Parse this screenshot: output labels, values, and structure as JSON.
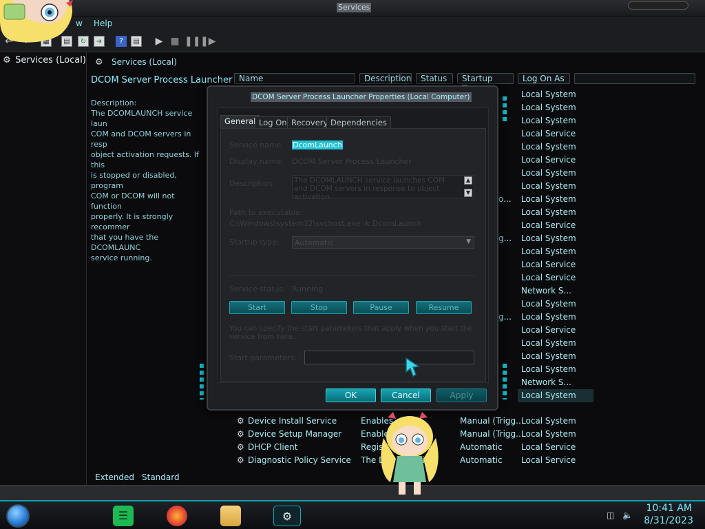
{
  "window": {
    "title": "Services"
  },
  "menu": {
    "items": [
      "w",
      "Help"
    ]
  },
  "tree": {
    "root_label": "Services (Local)"
  },
  "main": {
    "header_label": "Services (Local)",
    "selected_service_title": "DCOM Server Process Launcher",
    "description_lines": [
      "Description:",
      "The DCOMLAUNCH service laun",
      "COM and DCOM servers in resp",
      "object activation requests. If this",
      "is stopped or disabled, program",
      "COM or DCOM will not function",
      "properly. It is strongly recommer",
      "that you have the DCOMLAUNC",
      "service running."
    ],
    "columns": [
      "Name",
      "Description",
      "Status",
      "Startup Type",
      "Log On As"
    ],
    "logon_values": [
      "Local System",
      "Local System",
      "Local System",
      "Local Service",
      "Local System",
      "Local Service",
      "Local System",
      "Local System",
      "Local System",
      "Local System",
      "Local Service",
      "Local System",
      "Local System",
      "Local Service",
      "Local Service",
      "Network S...",
      "Local System",
      "Local System",
      "Local Service",
      "Local System",
      "Local System",
      "Local System",
      "Network S...",
      "Local System"
    ],
    "clipped_values": [
      "",
      "",
      "",
      "",
      "",
      "",
      "",
      "",
      "o...",
      "",
      "",
      "g...",
      "",
      "",
      "",
      "",
      "",
      "g...",
      "",
      "",
      "",
      "",
      "",
      ""
    ],
    "bottom_rows": [
      {
        "name": "Device Install Service",
        "desc": "Enables",
        "status": "",
        "startup": "Manual (Trigg...",
        "logon": "Local System"
      },
      {
        "name": "Device Setup Manager",
        "desc": "Enable",
        "status": "",
        "startup": "Manual (Trigg...",
        "logon": "Local System"
      },
      {
        "name": "DHCP Client",
        "desc": "Regist",
        "status": "ning",
        "startup": "Automatic",
        "logon": "Local Service"
      },
      {
        "name": "Diagnostic Policy Service",
        "desc": "The D",
        "status": "ning",
        "startup": "Automatic",
        "logon": "Local Service"
      }
    ],
    "bottom_tabs": [
      "Extended",
      "Standard"
    ]
  },
  "dialog": {
    "title": "DCOM Server Process Launcher Properties (Local Computer)",
    "tabs": [
      "General",
      "Log On",
      "Recovery",
      "Dependencies"
    ],
    "service_name_label": "Service name:",
    "service_name_value": "DcomLaunch",
    "display_name_label": "Display name:",
    "display_name_value": "DCOM Server Process Launcher",
    "description_label": "Description:",
    "description_value": "The DCOMLAUNCH service launches COM and DCOM servers in response to object activation",
    "path_label": "Path to executable:",
    "path_value": "C:\\Windows\\system32\\svchost.exe -k DcomLaunch",
    "startup_label": "Startup type:",
    "startup_value": "Automatic",
    "status_label": "Service status:",
    "status_value": "Running",
    "service_buttons": [
      "Start",
      "Stop",
      "Pause",
      "Resume"
    ],
    "param_hint": "You can specify the start parameters that apply when you start the service from here.",
    "param_label": "Start parameters:",
    "buttons": {
      "ok": "OK",
      "cancel": "Cancel",
      "apply": "Apply"
    }
  },
  "taskbar": {
    "time": "10:41 AM",
    "date": "8/31/2023"
  },
  "icons": {
    "gear": "gear-icon",
    "back": "arrow-left-icon",
    "forward": "arrow-right-icon",
    "play": "play-icon",
    "stop": "stop-icon",
    "pause": "pause-icon",
    "restart": "restart-icon"
  }
}
